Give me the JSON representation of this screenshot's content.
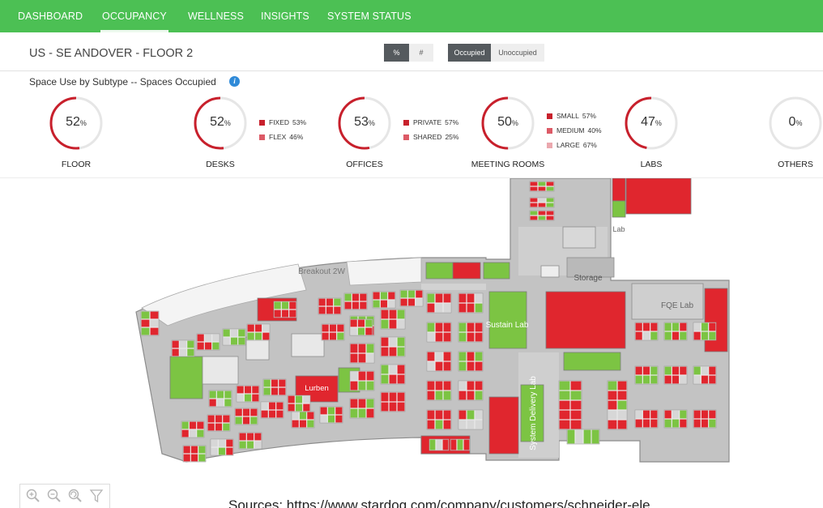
{
  "nav": {
    "tabs": [
      {
        "label": "DASHBOARD"
      },
      {
        "label": "OCCUPANCY"
      },
      {
        "label": "WELLNESS"
      },
      {
        "label": "INSIGHTS"
      },
      {
        "label": "SYSTEM STATUS"
      }
    ],
    "active_tab": "OCCUPANCY"
  },
  "header": {
    "title": "US - SE ANDOVER - FLOOR 2",
    "unit_toggle": {
      "percent_label": "%",
      "count_label": "#",
      "selected": "%"
    },
    "state_toggle": {
      "occupied_label": "Occupied",
      "unoccupied_label": "Unoccupied",
      "selected": "Occupied"
    }
  },
  "metrics": {
    "section_title": "Space Use by Subtype -- Spaces Occupied",
    "info_icon": "info-icon",
    "percent_symbol": "%",
    "gauges": [
      {
        "label": "FLOOR",
        "value": 52,
        "legend": []
      },
      {
        "label": "DESKS",
        "value": 52,
        "legend": [
          {
            "label": "FIXED",
            "value": "53%",
            "color": "#c8202c"
          },
          {
            "label": "FLEX",
            "value": "46%",
            "color": "#dc5a66"
          }
        ]
      },
      {
        "label": "OFFICES",
        "value": 53,
        "legend": [
          {
            "label": "PRIVATE",
            "value": "57%",
            "color": "#c8202c"
          },
          {
            "label": "SHARED",
            "value": "25%",
            "color": "#dc5a66"
          }
        ]
      },
      {
        "label": "MEETING ROOMS",
        "value": 50,
        "legend": [
          {
            "label": "SMALL",
            "value": "57%",
            "color": "#c8202c"
          },
          {
            "label": "MEDIUM",
            "value": "40%",
            "color": "#dc5a66"
          },
          {
            "label": "LARGE",
            "value": "67%",
            "color": "#eba8ae"
          }
        ]
      },
      {
        "label": "LABS",
        "value": 47,
        "legend": []
      },
      {
        "label": "OTHERS",
        "value": 0,
        "legend": []
      }
    ],
    "colors": {
      "arc": "#c8202c",
      "track": "#e6e6e6"
    }
  },
  "floor_map": {
    "room_labels": {
      "breakout": "Breakout 2W",
      "storage": "Storage",
      "lab": "Lab",
      "fqe_lab": "FQE Lab",
      "sustain_lab": "Sustain Lab",
      "lurben": "Lurben",
      "system_delivery_lab": "System Delivery Lab"
    },
    "colors": {
      "occupied": "#e0262e",
      "unoccupied": "#7cc443",
      "floor": "#c3c3c3",
      "wall": "#8c8c8c",
      "window": "#f4f4f4"
    }
  },
  "tools": [
    "zoom-in-icon",
    "zoom-out-icon",
    "reset-view-icon",
    "filter-icon"
  ],
  "footer": {
    "source": "Sources: https://www.stardog.com/company/customers/schneider-ele"
  }
}
